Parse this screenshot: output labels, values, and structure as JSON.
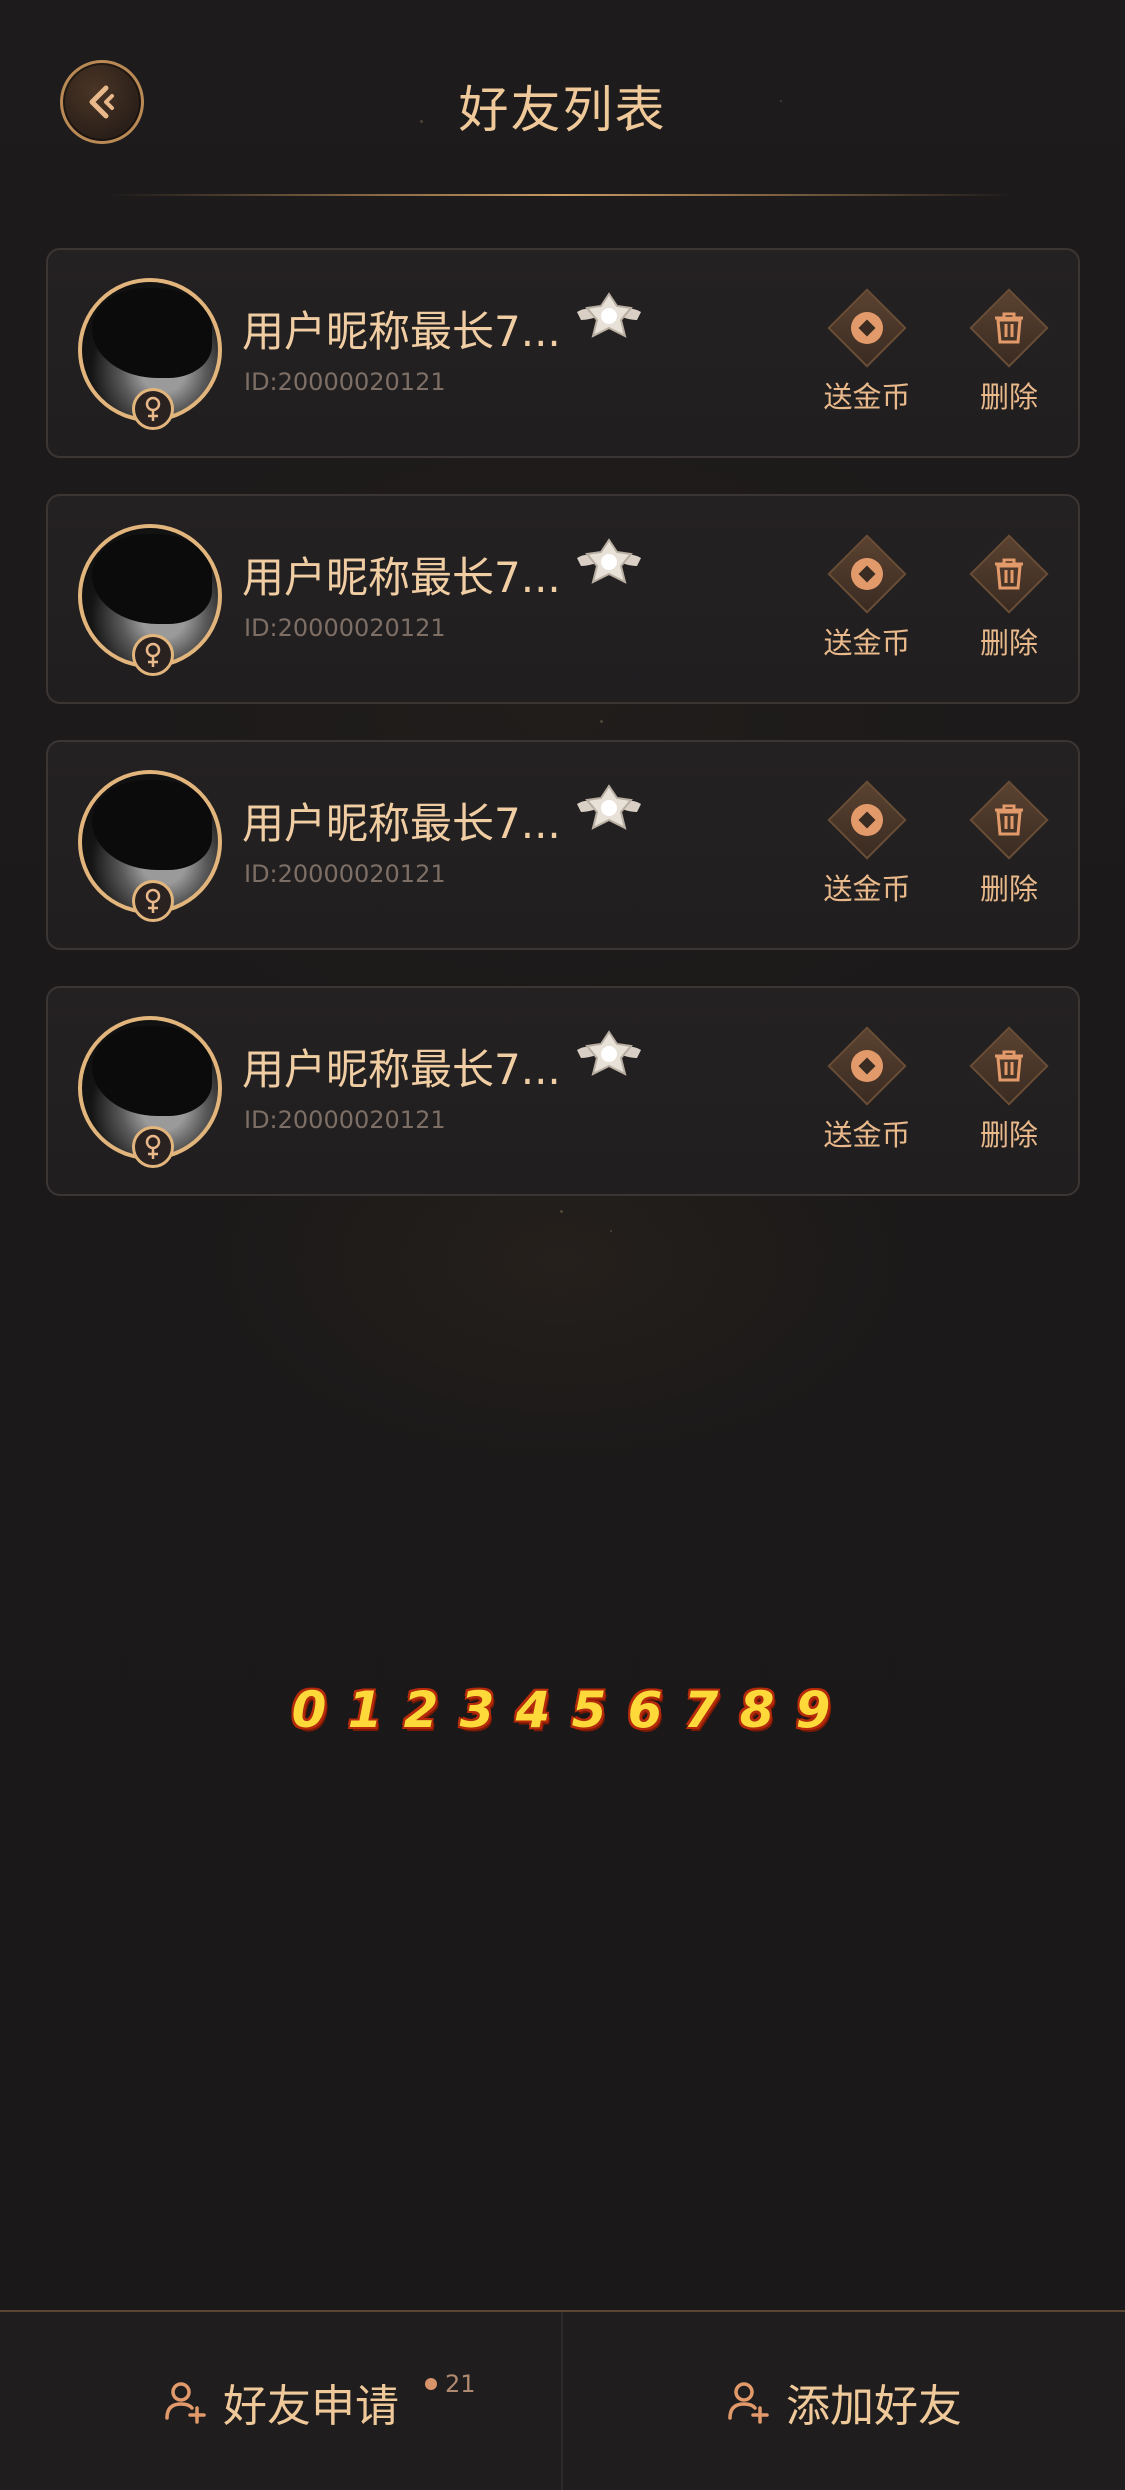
{
  "header": {
    "title": "好友列表"
  },
  "friends": [
    {
      "nickname": "用户昵称最长7...",
      "id": "ID:20000020121",
      "gift_label": "送金币",
      "delete_label": "删除"
    },
    {
      "nickname": "用户昵称最长7...",
      "id": "ID:20000020121",
      "gift_label": "送金币",
      "delete_label": "删除"
    },
    {
      "nickname": "用户昵称最长7...",
      "id": "ID:20000020121",
      "gift_label": "送金币",
      "delete_label": "删除"
    },
    {
      "nickname": "用户昵称最长7...",
      "id": "ID:20000020121",
      "gift_label": "送金币",
      "delete_label": "删除"
    }
  ],
  "digits": [
    "0",
    "1",
    "2",
    "3",
    "4",
    "5",
    "6",
    "7",
    "8",
    "9"
  ],
  "bottom_bar": {
    "friend_requests_label": "好友申请",
    "friend_requests_count": "21",
    "add_friend_label": "添加好友"
  },
  "colors": {
    "accent_gold": "#f0c99a",
    "background": "#1a1819"
  }
}
